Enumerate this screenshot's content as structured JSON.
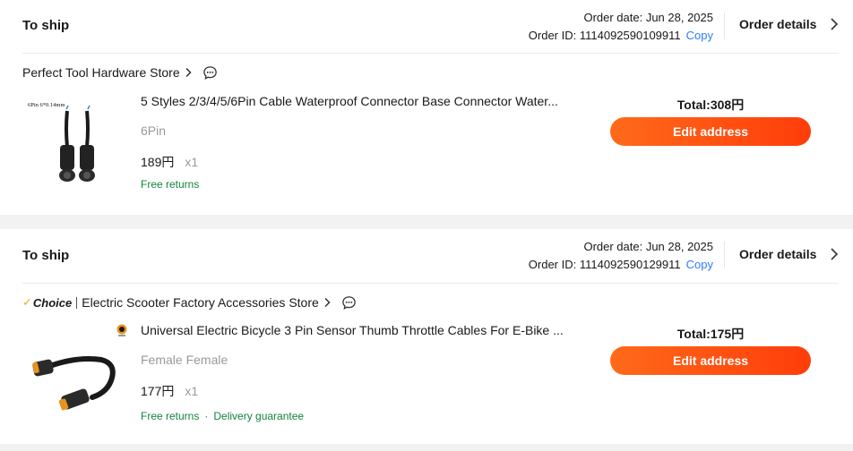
{
  "orders": [
    {
      "status": "To ship",
      "order_date": "Order date: Jun 28, 2025",
      "order_id": "Order ID: 1114092590109911",
      "copy_label": "Copy",
      "details_label": "Order details",
      "store_name": "Perfect Tool Hardware Store",
      "choice_label": "",
      "item_title": "5 Styles 2/3/4/5/6Pin Cable Waterproof Connector Base Connector Water...",
      "variant": "6Pin",
      "price": "189円",
      "quantity": "x1",
      "returns": "Free returns",
      "delivery": "",
      "total": "Total:308円",
      "edit_label": "Edit address",
      "thumb_caption": "6Pin 6*0.14mm"
    },
    {
      "status": "To ship",
      "order_date": "Order date: Jun 28, 2025",
      "order_id": "Order ID: 1114092590129911",
      "copy_label": "Copy",
      "details_label": "Order details",
      "store_name": "Electric Scooter Factory Accessories Store",
      "choice_label": "Choice",
      "item_title": "Universal Electric Bicycle 3 Pin Sensor Thumb Throttle Cables For E-Bike ...",
      "variant": "Female Female",
      "price": "177円",
      "quantity": "x1",
      "returns": "Free returns",
      "delivery": "Delivery guarantee",
      "total": "Total:175円",
      "edit_label": "Edit address"
    }
  ],
  "colors": {
    "accent": "#ff4d10",
    "link": "#2e7cf6",
    "green": "#12833b",
    "choice_tick": "#f5a623"
  }
}
